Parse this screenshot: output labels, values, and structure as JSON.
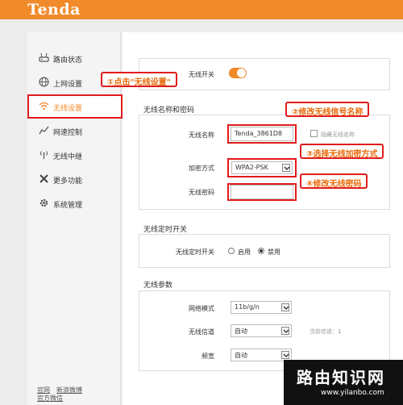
{
  "brand": {
    "logo_text": "Tenda",
    "accent": "#f08a2b",
    "annotation_color": "#e21b1b"
  },
  "sidebar": {
    "items": [
      {
        "label": "路由状态",
        "icon": "router-icon"
      },
      {
        "label": "上网设置",
        "icon": "globe-icon"
      },
      {
        "label": "无线设置",
        "icon": "wifi-icon",
        "active": true
      },
      {
        "label": "网速控制",
        "icon": "speed-chart-icon"
      },
      {
        "label": "无线中继",
        "icon": "repeater-icon"
      },
      {
        "label": "更多功能",
        "icon": "tools-icon"
      },
      {
        "label": "系统管理",
        "icon": "gear-icon"
      }
    ],
    "footer_links": [
      "官网",
      "新浪微博",
      "官方微信"
    ]
  },
  "wireless_switch": {
    "label": "无线开关",
    "enabled": true
  },
  "ssid_section": {
    "title": "无线名称和密码",
    "ssid_label": "无线名称",
    "ssid_value": "Tenda_3861D8",
    "hide_ssid_label": "隐藏无线名称",
    "encryption_label": "加密方式",
    "encryption_value": "WPA2-PSK",
    "password_label": "无线密码",
    "password_value": ""
  },
  "schedule_section": {
    "title": "无线定时开关",
    "label": "无线定时开关",
    "option_enable": "启用",
    "option_disable": "禁用",
    "selected": "禁用"
  },
  "params_section": {
    "title": "无线参数",
    "mode_label": "网络模式",
    "mode_value": "11b/g/n",
    "channel_label": "无线信道",
    "channel_value": "自动",
    "current_channel_hint": "当前信道：1",
    "bandwidth_label": "频宽",
    "bandwidth_value": "自动"
  },
  "annotations": {
    "step1": "①点击\"无线设置\"",
    "step2": "②修改无线信号名称",
    "step3": "③选择无线加密方式",
    "step4": "④修改无线密码"
  },
  "watermark": {
    "title": "路由知识网",
    "url": "www.yilanbo.com"
  }
}
